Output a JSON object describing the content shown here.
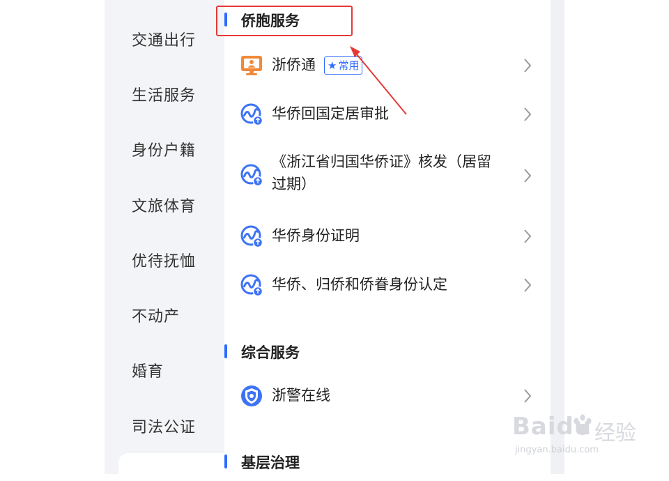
{
  "sidebar": {
    "items": [
      {
        "label": "交通出行"
      },
      {
        "label": "生活服务"
      },
      {
        "label": "身份户籍"
      },
      {
        "label": "文旅体育"
      },
      {
        "label": "优待抚恤"
      },
      {
        "label": "不动产"
      },
      {
        "label": "婚育"
      },
      {
        "label": "司法公证"
      }
    ]
  },
  "sections": [
    {
      "title": "侨胞服务"
    },
    {
      "title": "综合服务"
    },
    {
      "title": "基层治理"
    }
  ],
  "services": [
    {
      "label": "浙侨通",
      "badge": "常用",
      "icon": "user-monitor-icon"
    },
    {
      "label": "华侨回国定居审批",
      "icon": "globe-service-icon"
    },
    {
      "label_line1": "《浙江省归国华侨证》核发（居留",
      "label_line2": "过期）",
      "icon": "globe-service-icon"
    },
    {
      "label": "华侨身份证明",
      "icon": "globe-service-icon"
    },
    {
      "label": "华侨、归侨和侨眷身份认定",
      "icon": "globe-service-icon"
    },
    {
      "label": "浙警在线",
      "icon": "police-shield-icon"
    }
  ],
  "watermark": {
    "brand": "Baidu",
    "cn": "经验",
    "url": "jingyan.baidu.com"
  },
  "colors": {
    "accent": "#2f6bff",
    "annotation": "#e53935",
    "icon_orange": "#f08a3a"
  }
}
